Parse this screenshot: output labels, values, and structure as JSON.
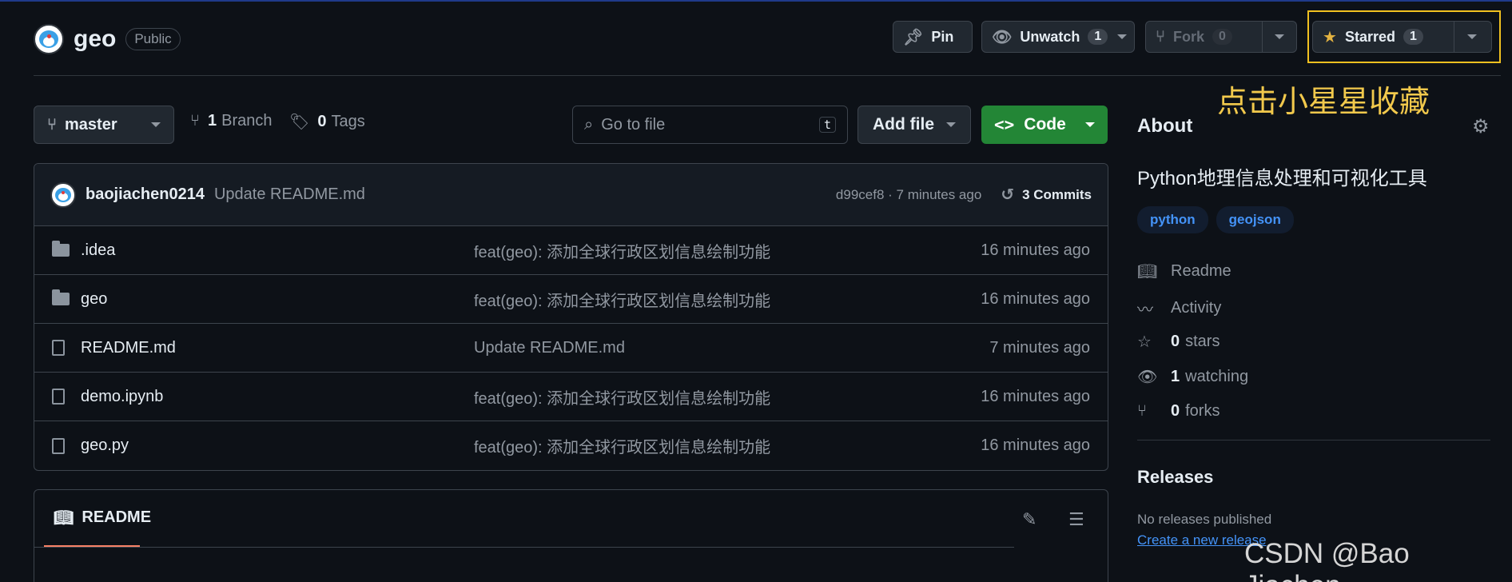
{
  "repo": {
    "name": "geo",
    "visibility": "Public"
  },
  "header_actions": {
    "pin_label": "Pin",
    "unwatch_label": "Unwatch",
    "unwatch_count": "1",
    "fork_label": "Fork",
    "fork_count": "0",
    "starred_label": "Starred",
    "starred_count": "1"
  },
  "annotation": "点击小星星收藏",
  "toolbar": {
    "branch": "master",
    "branch_count": "1",
    "branch_label": "Branch",
    "tag_count": "0",
    "tag_label": "Tags",
    "search_placeholder": "Go to file",
    "search_shortcut": "t",
    "add_file_label": "Add file",
    "code_label": "Code"
  },
  "latest_commit": {
    "author": "baojiachen0214",
    "message": "Update README.md",
    "hash_time": "d99cef8 · 7 minutes ago",
    "commits_label": "3 Commits"
  },
  "files": [
    {
      "type": "folder",
      "name": ".idea",
      "message": "feat(geo): 添加全球行政区划信息绘制功能",
      "time": "16 minutes ago"
    },
    {
      "type": "folder",
      "name": "geo",
      "message": "feat(geo): 添加全球行政区划信息绘制功能",
      "time": "16 minutes ago"
    },
    {
      "type": "file",
      "name": "README.md",
      "message": "Update README.md",
      "time": "7 minutes ago"
    },
    {
      "type": "file",
      "name": "demo.ipynb",
      "message": "feat(geo): 添加全球行政区划信息绘制功能",
      "time": "16 minutes ago"
    },
    {
      "type": "file",
      "name": "geo.py",
      "message": "feat(geo): 添加全球行政区划信息绘制功能",
      "time": "16 minutes ago"
    }
  ],
  "readme": {
    "tab_label": "README"
  },
  "about": {
    "title": "About",
    "description": "Python地理信息处理和可视化工具",
    "topics": [
      "python",
      "geojson"
    ],
    "readme": "Readme",
    "activity": "Activity",
    "stars_count": "0",
    "stars_label": "stars",
    "watching_count": "1",
    "watching_label": "watching",
    "forks_count": "0",
    "forks_label": "forks"
  },
  "releases": {
    "title": "Releases",
    "none_text": "No releases published",
    "create_link": "Create a new release"
  },
  "watermark": "CSDN @Bao Jiachen",
  "icons": {
    "pin": "pin-icon",
    "eye": "eye-icon",
    "fork": "fork-icon",
    "star": "star-icon",
    "branch": "branch-icon",
    "tag": "tag-icon",
    "search": "search-icon",
    "code": "code-icon",
    "history": "history-icon",
    "book": "book-icon",
    "pulse": "pulse-icon",
    "gear": "gear-icon",
    "pencil": "pencil-icon",
    "list": "list-icon"
  },
  "colors": {
    "accent_green": "#238636",
    "link_blue": "#4493f8",
    "star_yellow": "#e3b341",
    "annotation_yellow": "#f2c94c",
    "tab_underline": "#f78166"
  }
}
